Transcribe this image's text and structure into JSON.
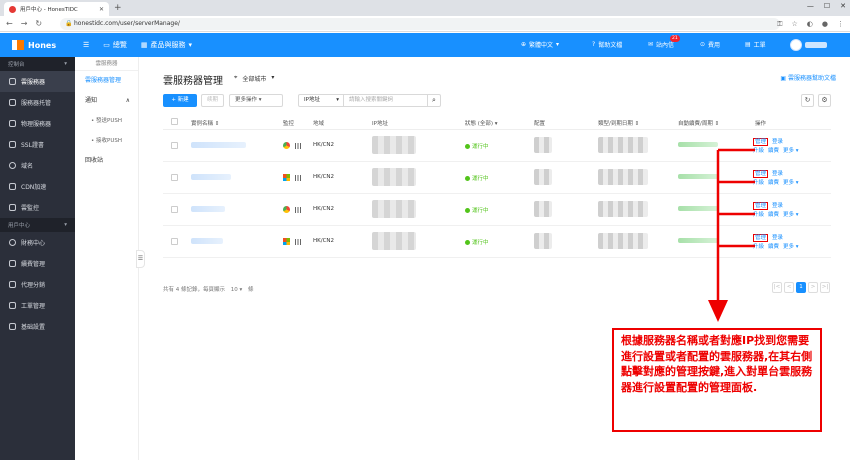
{
  "browser": {
    "tab_title": "用戶中心 - HonesTIDC",
    "url": "honestidc.com/user/serverManage/"
  },
  "topbar": {
    "logo_text": "Hones",
    "overview": "總覽",
    "products": "產品與服務",
    "lang": "繁體中文",
    "help": "幫助文檔",
    "inbox": "站內信",
    "inbox_count": "21",
    "billing": "費用",
    "ticket": "工單"
  },
  "sidebar": {
    "group1": "控制台",
    "items1": [
      "雲服務器",
      "服務器托管",
      "物理服務器",
      "SSL證書",
      "域名",
      "CDN加速",
      "雲監控"
    ],
    "group2": "用戶中心",
    "items2": [
      "財務中心",
      "續費管理",
      "代理分銷",
      "工單管理",
      "基础設置"
    ]
  },
  "subnav": {
    "header": "雲服務器",
    "items": [
      "雲服務器管理",
      "通知",
      "發送PUSH",
      "接收PUSH",
      "回收站"
    ]
  },
  "main": {
    "title": "雲服務器管理",
    "region": "全部城市",
    "help_link": "雲服務器幫助文檔",
    "new_btn": "+ 新建",
    "renew_btn": "续期",
    "more_btn": "更多操作",
    "filter_select": "IP地址",
    "search_placeholder": "請輸入搜索關鍵詞",
    "columns": [
      "實例名稱",
      "監控",
      "地域",
      "IP地址",
      "狀態 (全部)",
      "配置",
      "類型/到期日期",
      "自動續費/周期",
      "操作"
    ],
    "rows": [
      {
        "os": "chrome",
        "region": "HK/CN2",
        "status": "運行中"
      },
      {
        "os": "windows",
        "region": "HK/CN2",
        "status": "運行中"
      },
      {
        "os": "chrome",
        "region": "HK/CN2",
        "status": "運行中"
      },
      {
        "os": "windows",
        "region": "HK/CN2",
        "status": "運行中"
      }
    ],
    "op": {
      "manage": "管理",
      "login": "登录",
      "upgrade": "升級",
      "renew": "續費",
      "more": "更多"
    },
    "footer_prefix": "共有 4 條記錄，每頁顯示",
    "page_size": "10",
    "footer_suffix": "條",
    "pages": [
      "|<",
      "<",
      "1",
      ">",
      ">|"
    ]
  },
  "annotation": "根據服務器名稱或者對應IP找到您需要進行設置或者配置的雲服務器,在其右側點擊對應的管理按鍵,進入對單台雲服務器進行設置配置的管理面板.",
  "colors": {
    "primary": "#1890ff",
    "annotation": "#e00000",
    "sidebar": "#2b2f3a"
  }
}
